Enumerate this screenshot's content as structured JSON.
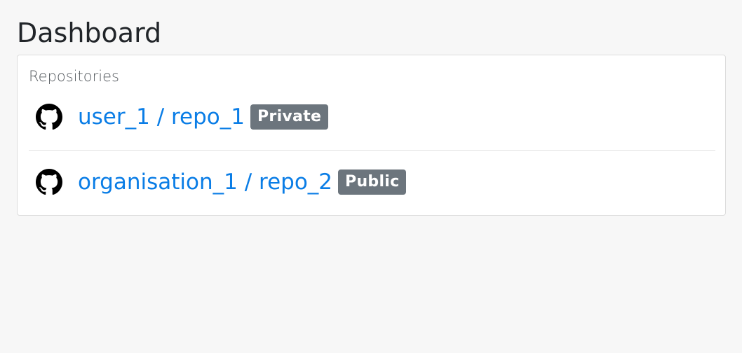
{
  "page": {
    "title": "Dashboard"
  },
  "repositories": {
    "label": "Repositories",
    "items": [
      {
        "name": "user_1 / repo_1",
        "visibility": "Private",
        "icon": "github-icon"
      },
      {
        "name": "organisation_1 / repo_2",
        "visibility": "Public",
        "icon": "github-icon"
      }
    ]
  },
  "colors": {
    "link": "#0a7de6",
    "badge_bg": "#6c757d",
    "page_bg": "#f7f7f7"
  }
}
